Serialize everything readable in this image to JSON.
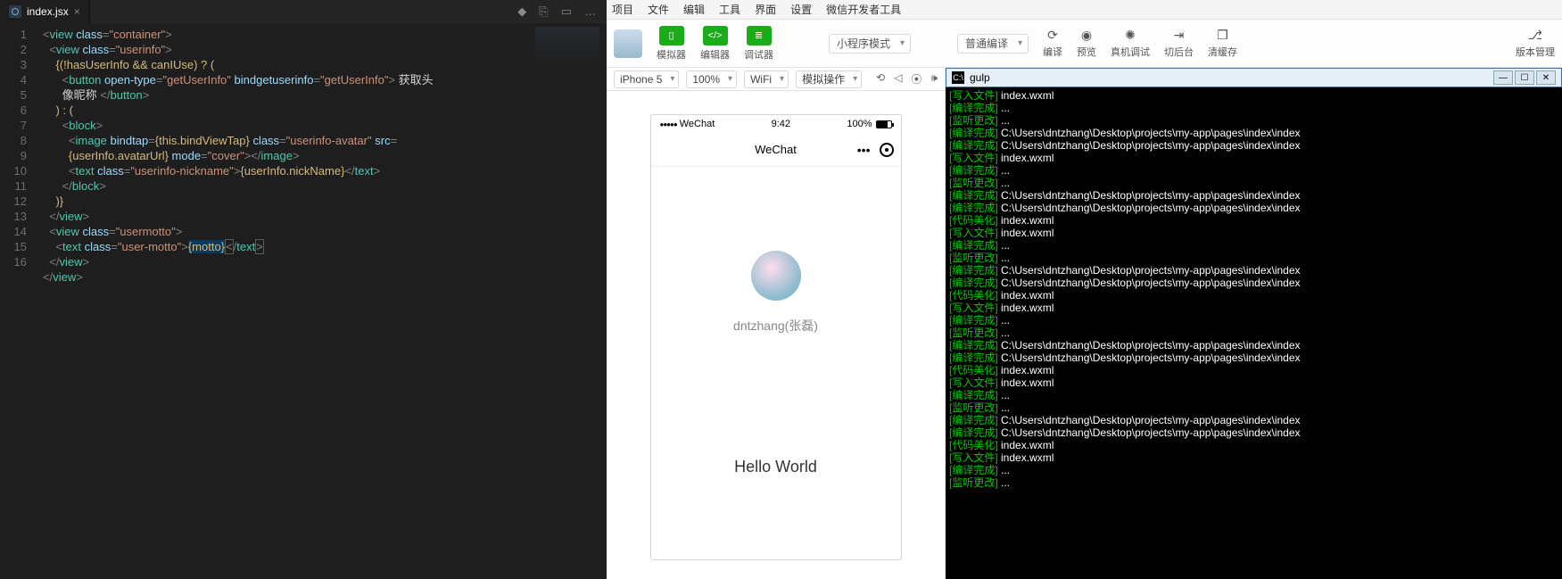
{
  "editor": {
    "tab": {
      "filename": "index.jsx"
    },
    "icons": {
      "lint": "◆",
      "git": "⎘",
      "split": "▭",
      "more": "…"
    },
    "code": {
      "l1": {
        "tag": "view",
        "attr": "class",
        "val": "container"
      },
      "l2": {
        "tag": "view",
        "attr": "class",
        "val": "userinfo"
      },
      "l3": {
        "expr": "{(!hasUserInfo && canIUse) ? ("
      },
      "l4a": {
        "tag": "button",
        "a1": "open-type",
        "v1": "getUserInfo",
        "a2": "bindgetuserinfo",
        "v2": "getUserInfo",
        "txt": " 获取头"
      },
      "l4b": {
        "txt": "像昵称 ",
        "close": "</button>"
      },
      "l5": {
        "expr": ") : ("
      },
      "l6": {
        "tag": "block"
      },
      "l7a": {
        "tag": "image",
        "a1": "bindtap",
        "v1": "this.bindViewTap",
        "a2": "class",
        "v2": "userinfo-avatar",
        "a3": "src"
      },
      "l7b": {
        "v1": "userInfo.avatarUrl",
        "a2": "mode",
        "v2": "cover",
        "close": "</image>"
      },
      "l8": {
        "tag": "text",
        "a1": "class",
        "v1": "userinfo-nickname",
        "expr": "{userInfo.nickName}",
        "close": "</text>"
      },
      "l9": {
        "close": "</block>"
      },
      "l10": {
        "expr": ")}"
      },
      "l11": {
        "close": "</view>"
      },
      "l12": {
        "tag": "view",
        "a1": "class",
        "v1": "usermotto"
      },
      "l13": {
        "tag": "text",
        "a1": "class",
        "v1": "user-motto",
        "expr": "{motto}",
        "close": "</text>"
      },
      "l14": {
        "close": "</view>"
      },
      "l15": {
        "close": "</view>"
      }
    },
    "line_count": 16
  },
  "wx": {
    "menu": [
      "项目",
      "文件",
      "编辑",
      "工具",
      "界面",
      "设置",
      "微信开发者工具"
    ],
    "toolbar": {
      "sim": "模拟器",
      "edit": "编辑器",
      "dbg": "调试器",
      "mode": "小程序模式",
      "compile_mode": "普通编译",
      "compile": "编译",
      "preview": "预览",
      "remote": "真机调试",
      "bg": "切后台",
      "cache": "清缓存",
      "ver": "版本管理"
    },
    "sim": {
      "device": "iPhone 5",
      "zoom": "100%",
      "net": "WiFi",
      "mock": "模拟操作",
      "status_carrier": "WeChat",
      "status_time": "9:42",
      "status_batt": "100%",
      "nav_title": "WeChat",
      "nickname": "dntzhang(张磊)",
      "motto": "Hello World"
    }
  },
  "term": {
    "title": "gulp",
    "labels": {
      "write": "[写入文件]",
      "compile": "[编译完成]",
      "listen": "[监听更改]",
      "beautify": "[代码美化]"
    },
    "file": "index.wxml",
    "dots": "...",
    "path": "C:\\Users\\dntzhang\\Desktop\\projects\\my-app\\pages\\index\\index",
    "lines": [
      "write:file",
      "compile:dots",
      "listen:dots",
      "compile:path",
      "compile:path",
      "write:file",
      "compile:dots",
      "listen:dots",
      "compile:path",
      "compile:path",
      "beautify:file",
      "write:file",
      "compile:dots",
      "listen:dots",
      "compile:path",
      "compile:path",
      "beautify:file",
      "write:file",
      "compile:dots",
      "listen:dots",
      "compile:path",
      "compile:path",
      "beautify:file",
      "write:file",
      "compile:dots",
      "listen:dots",
      "compile:path",
      "compile:path",
      "beautify:file",
      "write:file",
      "compile:dots",
      "listen:dots"
    ]
  }
}
